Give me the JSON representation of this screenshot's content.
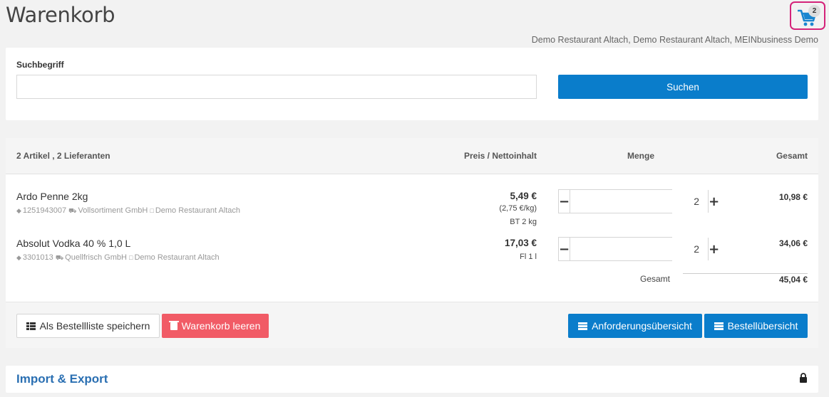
{
  "page": {
    "title": "Warenkorb"
  },
  "cart_button": {
    "count": "2",
    "icon": "shopping-cart-icon",
    "border_color": "#d4237a"
  },
  "context": "Demo Restaurant Altach, Demo Restaurant Altach, MEINbusiness Demo",
  "search": {
    "label": "Suchbegriff",
    "value": "",
    "placeholder": "",
    "button_label": "Suchen"
  },
  "cart": {
    "summary": "2 Artikel , 2 Lieferanten",
    "columns": {
      "price": "Preis / Nettoinhalt",
      "quantity": "Menge",
      "total": "Gesamt"
    },
    "items": [
      {
        "name": "Ardo Penne 2kg",
        "sku": "1251943007",
        "supplier": "Vollsortiment GmbH",
        "location": "Demo Restaurant Altach",
        "price": "5,49 €",
        "unit_price": "(2,75 €/kg)",
        "content": "BT 2 kg",
        "quantity": "2",
        "total": "10,98 €"
      },
      {
        "name": "Absolut Vodka 40 % 1,0 L",
        "sku": "3301013",
        "supplier": "Quellfrisch GmbH",
        "location": "Demo Restaurant Altach",
        "price": "17,03 €",
        "content": "Fl 1 l",
        "quantity": "2",
        "total": "34,06 €"
      }
    ],
    "grand_total_label": "Gesamt",
    "grand_total": "45,04 €"
  },
  "actions": {
    "save_list": "Als Bestellliste speichern",
    "clear_cart": "Warenkorb leeren",
    "requests_overview": "Anforderungsübersicht",
    "order_overview": "Bestellübersicht"
  },
  "import_export": {
    "title": "Import & Export",
    "icon": "lock-icon"
  },
  "colors": {
    "primary": "#0a7dcb",
    "danger": "#f15b66",
    "link": "#2a6fb2"
  }
}
